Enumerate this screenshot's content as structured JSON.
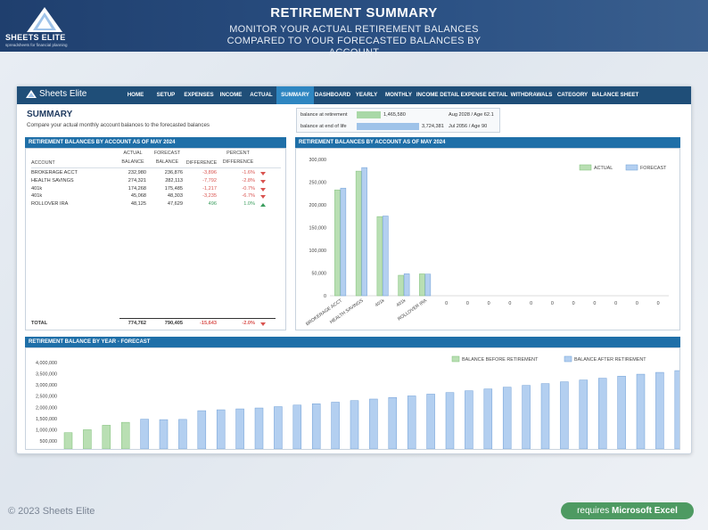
{
  "brand": {
    "name": "SHEETS ELITE",
    "tagline": "spreadsheets for financial planning",
    "nav_brand": "Sheets Elite"
  },
  "banner": {
    "title": "RETIREMENT SUMMARY",
    "subtitle": "MONITOR YOUR ACTUAL RETIREMENT BALANCES COMPARED TO YOUR FORECASTED BALANCES BY ACCOUNT"
  },
  "nav": [
    "HOME",
    "SETUP",
    "EXPENSES",
    "INCOME",
    "ACTUAL",
    "SUMMARY",
    "DASHBOARD",
    "YEARLY",
    "MONTHLY",
    "INCOME DETAIL",
    "EXPENSE DETAIL",
    "WITHDRAWALS",
    "CATEGORY",
    "BALANCE SHEET"
  ],
  "nav_active": "SUMMARY",
  "summary": {
    "title": "SUMMARY",
    "description": "Compare your actual monthly account balances to the forecasted balances"
  },
  "retirement_box": {
    "rows": [
      {
        "label": "balance at retirement",
        "value": "1,465,580",
        "date": "Aug 2028 / Age 62.1",
        "fill": 0.39,
        "color": "#a9d8a7"
      },
      {
        "label": "balance at end of life",
        "value": "3,724,381",
        "date": "Jul 2056 / Age 90",
        "fill": 1.0,
        "color": "#9fc3e9"
      }
    ]
  },
  "table_section": {
    "header": "RETIREMENT BALANCES BY ACCOUNT AS OF MAY 2024",
    "columns": [
      "ACCOUNT",
      "ACTUAL BALANCE",
      "FORECAST BALANCE",
      "DIFFERENCE",
      "PERCENT DIFFERENCE"
    ],
    "col_actual_l1": "ACTUAL",
    "col_actual_l2": "BALANCE",
    "col_forecast_l1": "FORECAST",
    "col_forecast_l2": "BALANCE",
    "col_diff": "DIFFERENCE",
    "col_pct_l1": "PERCENT",
    "col_pct_l2": "DIFFERENCE",
    "col_account": "ACCOUNT",
    "rows": [
      {
        "account": "BROKERAGE ACCT",
        "actual": "232,980",
        "forecast": "236,876",
        "diff": "-3,896",
        "pct": "-1.6%",
        "dir": "down"
      },
      {
        "account": "HEALTH SAVINGS",
        "actual": "274,321",
        "forecast": "282,113",
        "diff": "-7,792",
        "pct": "-2.8%",
        "dir": "down"
      },
      {
        "account": "401k",
        "actual": "174,268",
        "forecast": "175,485",
        "diff": "-1,217",
        "pct": "-0.7%",
        "dir": "down"
      },
      {
        "account": "401k",
        "actual": "45,068",
        "forecast": "48,303",
        "diff": "-3,235",
        "pct": "-6.7%",
        "dir": "down"
      },
      {
        "account": "ROLLOVER IRA",
        "actual": "48,125",
        "forecast": "47,629",
        "diff": "496",
        "pct": "1.0%",
        "dir": "up"
      }
    ],
    "total": {
      "label": "TOTAL",
      "actual": "774,762",
      "forecast": "790,405",
      "diff": "-15,643",
      "pct": "-2.0%",
      "dir": "down"
    }
  },
  "chart_data": [
    {
      "type": "bar",
      "title": "RETIREMENT BALANCES BY ACCOUNT AS OF MAY 2024",
      "categories": [
        "BROKERAGE ACCT",
        "HEALTH SAVINGS",
        "401k",
        "401k",
        "ROLLOVER IRA",
        "0",
        "0",
        "0",
        "0",
        "0",
        "0",
        "0",
        "0",
        "0",
        "0",
        "0"
      ],
      "series": [
        {
          "name": "ACTUAL",
          "color": "#b9dfb3",
          "values": [
            232980,
            274321,
            174268,
            45068,
            48125,
            0,
            0,
            0,
            0,
            0,
            0,
            0,
            0,
            0,
            0,
            0
          ]
        },
        {
          "name": "FORECAST",
          "color": "#b3cff0",
          "values": [
            236876,
            282113,
            175485,
            48303,
            47629,
            0,
            0,
            0,
            0,
            0,
            0,
            0,
            0,
            0,
            0,
            0
          ]
        }
      ],
      "yticks": [
        "300,000",
        "250,000",
        "200,000",
        "150,000",
        "100,000",
        "50,000",
        "0"
      ],
      "ylim": [
        0,
        300000
      ],
      "legend": "top-right"
    },
    {
      "type": "bar",
      "title": "RETIREMENT BALANCE BY YEAR - FORECAST",
      "series": [
        {
          "name": "BALANCE BEFORE RETIREMENT",
          "color": "#b9dfb3",
          "values": [
            870000,
            1000000,
            1200000,
            1330000
          ]
        },
        {
          "name": "BALANCE AFTER RETIREMENT",
          "color": "#b3cff0",
          "values": [
            1470000,
            1450000,
            1460000,
            1850000,
            1890000,
            1930000,
            1970000,
            2030000,
            2100000,
            2160000,
            2230000,
            2300000,
            2370000,
            2440000,
            2510000,
            2590000,
            2660000,
            2740000,
            2820000,
            2900000,
            2980000,
            3060000,
            3140000,
            3220000,
            3300000,
            3390000,
            3480000,
            3560000,
            3640000
          ]
        }
      ],
      "yticks": [
        "4,000,000",
        "3,500,000",
        "3,000,000",
        "2,500,000",
        "2,000,000",
        "1,500,000",
        "1,000,000",
        "500,000"
      ],
      "ylim": [
        500000,
        4000000
      ],
      "legend": "top-right"
    }
  ],
  "footer": {
    "copyright": "© 2023 Sheets Elite",
    "requires_prefix": "requires ",
    "requires_product": "Microsoft Excel"
  }
}
